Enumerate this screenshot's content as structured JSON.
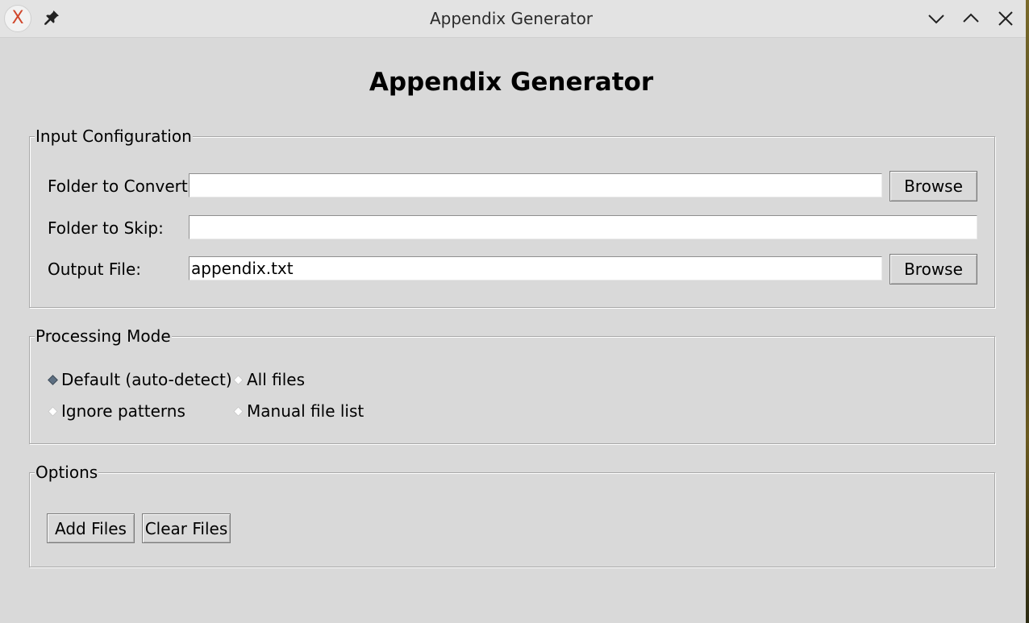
{
  "window": {
    "title": "Appendix Generator"
  },
  "heading": "Appendix Generator",
  "input_config": {
    "legend": "Input Configuration",
    "folder_convert_label": "Folder to Convert:",
    "folder_convert_value": "",
    "folder_skip_label": "Folder to Skip:",
    "folder_skip_value": "",
    "output_file_label": "Output File:",
    "output_file_value": "appendix.txt",
    "browse_label": "Browse"
  },
  "processing_mode": {
    "legend": "Processing Mode",
    "options": [
      {
        "label": "Default (auto-detect)",
        "selected": true
      },
      {
        "label": "All files",
        "selected": false
      },
      {
        "label": "Ignore patterns",
        "selected": false
      },
      {
        "label": "Manual file list",
        "selected": false
      }
    ]
  },
  "options": {
    "legend": "Options",
    "add_files_label": "Add Files",
    "clear_files_label": "Clear Files"
  },
  "icons": {
    "app": "app-x-icon",
    "pin": "pin-icon",
    "minimize": "chevron-down-icon",
    "maximize": "chevron-up-icon",
    "close": "close-icon"
  },
  "colors": {
    "background": "#d9d9d9",
    "titlebar": "#e3e3e3",
    "radio_selected": "#5d6f82"
  }
}
